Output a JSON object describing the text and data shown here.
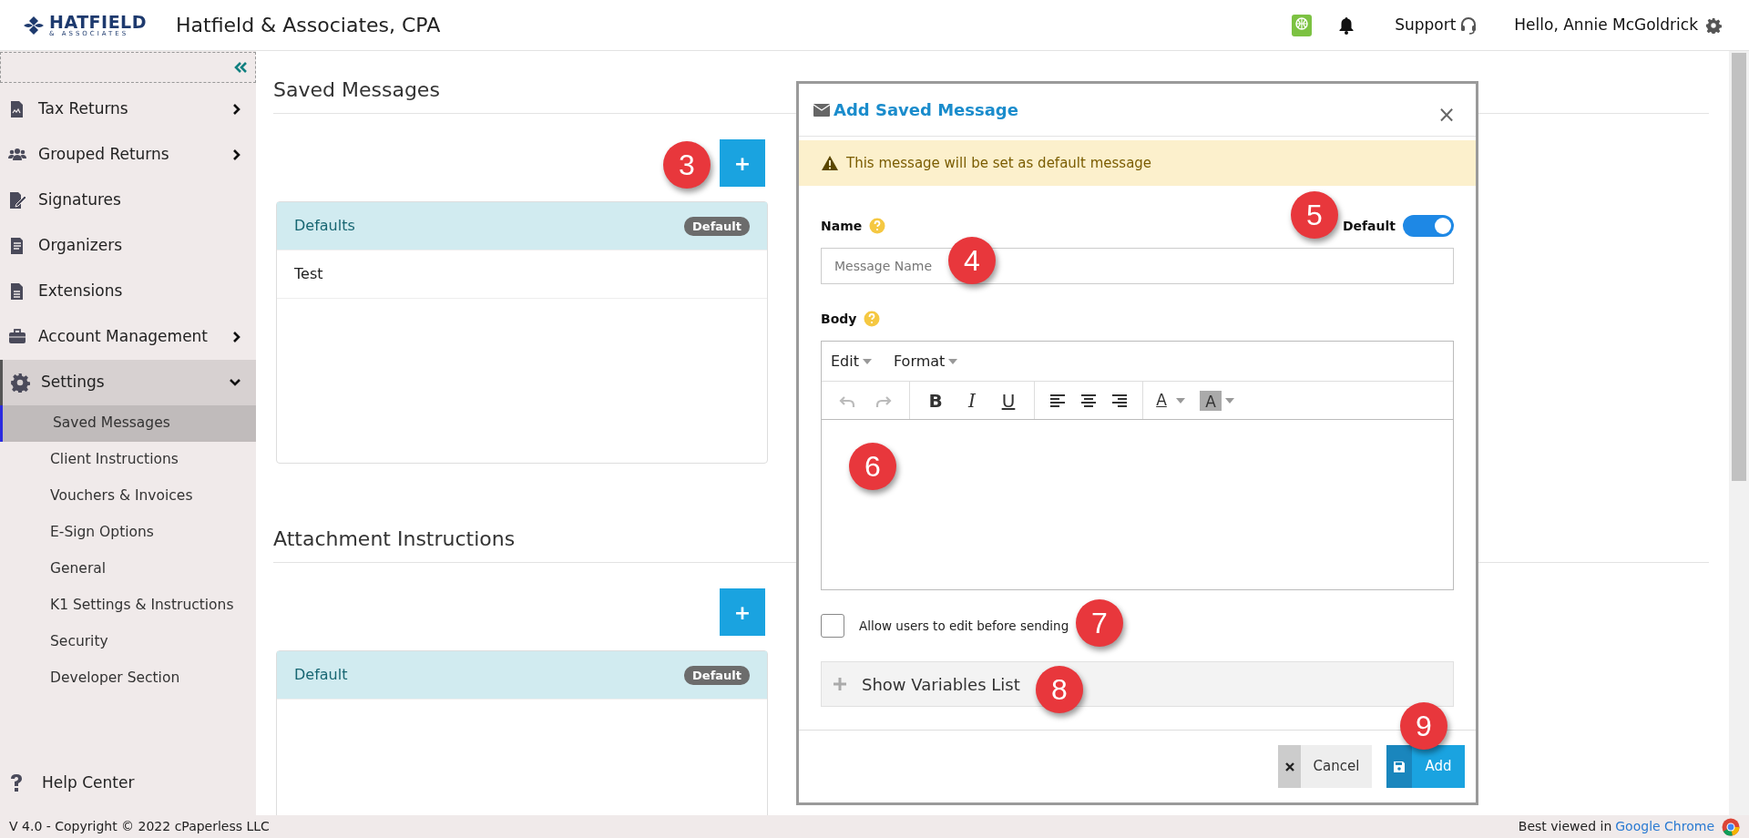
{
  "header": {
    "logo": {
      "name": "HATFIELD",
      "sub": "& ASSOCIATES"
    },
    "firm_title": "Hatfield & Associates, CPA",
    "support": "Support",
    "greeting": "Hello, Annie McGoldrick"
  },
  "sidebar": {
    "items": [
      {
        "label": "Tax Returns",
        "expanded": false,
        "selected": false
      },
      {
        "label": "Grouped Returns",
        "expanded": false,
        "selected": false
      },
      {
        "label": "Signatures",
        "selected": false
      },
      {
        "label": "Organizers",
        "selected": false
      },
      {
        "label": "Extensions",
        "selected": false
      },
      {
        "label": "Account Management",
        "expanded": false,
        "selected": false
      },
      {
        "label": "Settings",
        "expanded": true,
        "selected": true,
        "children": [
          {
            "label": "Saved Messages",
            "selected": true
          },
          {
            "label": "Client Instructions",
            "selected": false
          },
          {
            "label": "Vouchers & Invoices",
            "selected": false
          },
          {
            "label": "E-Sign Options",
            "selected": false
          },
          {
            "label": "General",
            "selected": false
          },
          {
            "label": "K1 Settings & Instructions",
            "selected": false
          },
          {
            "label": "Security",
            "selected": false
          },
          {
            "label": "Developer Section",
            "selected": false
          }
        ]
      }
    ],
    "help": "Help Center"
  },
  "sections": [
    {
      "title": "Saved Messages",
      "add_button": "+",
      "rows": [
        {
          "label": "Defaults",
          "badge": "Default",
          "selected": true
        },
        {
          "label": "Test",
          "selected": false
        }
      ]
    },
    {
      "title": "Attachment Instructions",
      "add_button": "+",
      "rows": [
        {
          "label": "Default",
          "badge": "Default",
          "selected": true
        }
      ]
    }
  ],
  "modal": {
    "title": "Add Saved Message",
    "close": "×",
    "alert": "This message will be set as default message",
    "name_label": "Name",
    "default_label": "Default",
    "default_on": true,
    "name_placeholder": "Message Name",
    "body_label": "Body",
    "editor": {
      "menus": [
        "Edit",
        "Format"
      ],
      "history": [
        {
          "kind": "undo",
          "disabled": true
        },
        {
          "kind": "redo",
          "disabled": true
        }
      ],
      "format": [
        {
          "label": "B",
          "kind": "bold"
        },
        {
          "label": "I",
          "kind": "italic"
        },
        {
          "label": "U",
          "kind": "underline"
        }
      ],
      "colors": [
        {
          "label": "A",
          "kind": "text"
        },
        {
          "label": "A",
          "kind": "background"
        }
      ]
    },
    "allow_edit": {
      "label": "Allow users to edit before sending",
      "checked": false
    },
    "variables": "Show Variables List",
    "buttons": [
      {
        "label": "Cancel",
        "kind": "cancel"
      },
      {
        "label": "Add",
        "kind": "primary"
      }
    ]
  },
  "annotations": [
    {
      "label": "3"
    },
    {
      "label": "4"
    },
    {
      "label": "5"
    },
    {
      "label": "6"
    },
    {
      "label": "7"
    },
    {
      "label": "8"
    },
    {
      "label": "9"
    }
  ],
  "footer": {
    "copyright": "V 4.0 - Copyright © 2022 cPaperless LLC",
    "best_viewed": "Best viewed in",
    "browser": "Google Chrome"
  }
}
